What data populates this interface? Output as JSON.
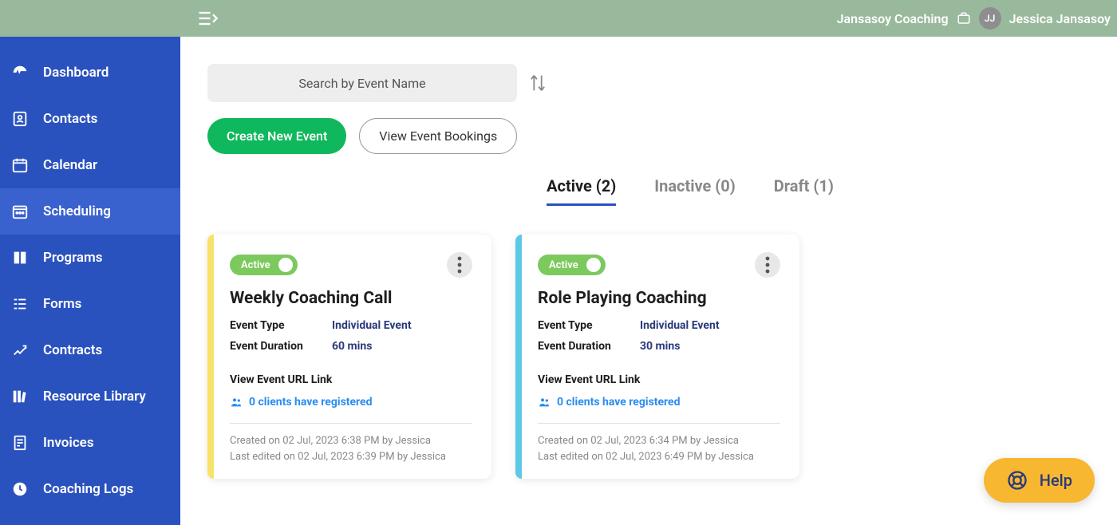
{
  "topbar": {
    "org_name": "Jansasoy Coaching",
    "user_initials": "JJ",
    "user_name": "Jessica Jansasoy"
  },
  "sidebar": {
    "items": [
      {
        "label": "Dashboard",
        "icon": "dashboard"
      },
      {
        "label": "Contacts",
        "icon": "contacts"
      },
      {
        "label": "Calendar",
        "icon": "calendar"
      },
      {
        "label": "Scheduling",
        "icon": "scheduling"
      },
      {
        "label": "Programs",
        "icon": "programs"
      },
      {
        "label": "Forms",
        "icon": "forms"
      },
      {
        "label": "Contracts",
        "icon": "contracts"
      },
      {
        "label": "Resource Library",
        "icon": "library"
      },
      {
        "label": "Invoices",
        "icon": "invoices"
      },
      {
        "label": "Coaching Logs",
        "icon": "coaching-logs"
      }
    ],
    "active_index": 3
  },
  "search": {
    "placeholder": "Search by Event Name"
  },
  "actions": {
    "create": "Create New Event",
    "view_bookings": "View Event Bookings"
  },
  "tabs": [
    {
      "label": "Active (2)",
      "active": true
    },
    {
      "label": "Inactive (0)",
      "active": false
    },
    {
      "label": "Draft (1)",
      "active": false
    }
  ],
  "events": [
    {
      "status": "Active",
      "accent": "yellow",
      "title": "Weekly Coaching Call",
      "type_label": "Event Type",
      "type_value": "Individual Event",
      "duration_label": "Event Duration",
      "duration_value": "60 mins",
      "url_link": "View Event URL Link",
      "clients": "0 clients have registered",
      "created": "Created on 02 Jul, 2023 6:38 PM by Jessica",
      "edited": "Last edited on 02 Jul, 2023 6:39 PM by Jessica"
    },
    {
      "status": "Active",
      "accent": "blue",
      "title": "Role Playing Coaching",
      "type_label": "Event Type",
      "type_value": "Individual Event",
      "duration_label": "Event Duration",
      "duration_value": "30 mins",
      "url_link": "View Event URL Link",
      "clients": "0 clients have registered",
      "created": "Created on 02 Jul, 2023 6:34 PM by Jessica",
      "edited": "Last edited on 02 Jul, 2023 6:49 PM by Jessica"
    }
  ],
  "help": {
    "label": "Help"
  }
}
